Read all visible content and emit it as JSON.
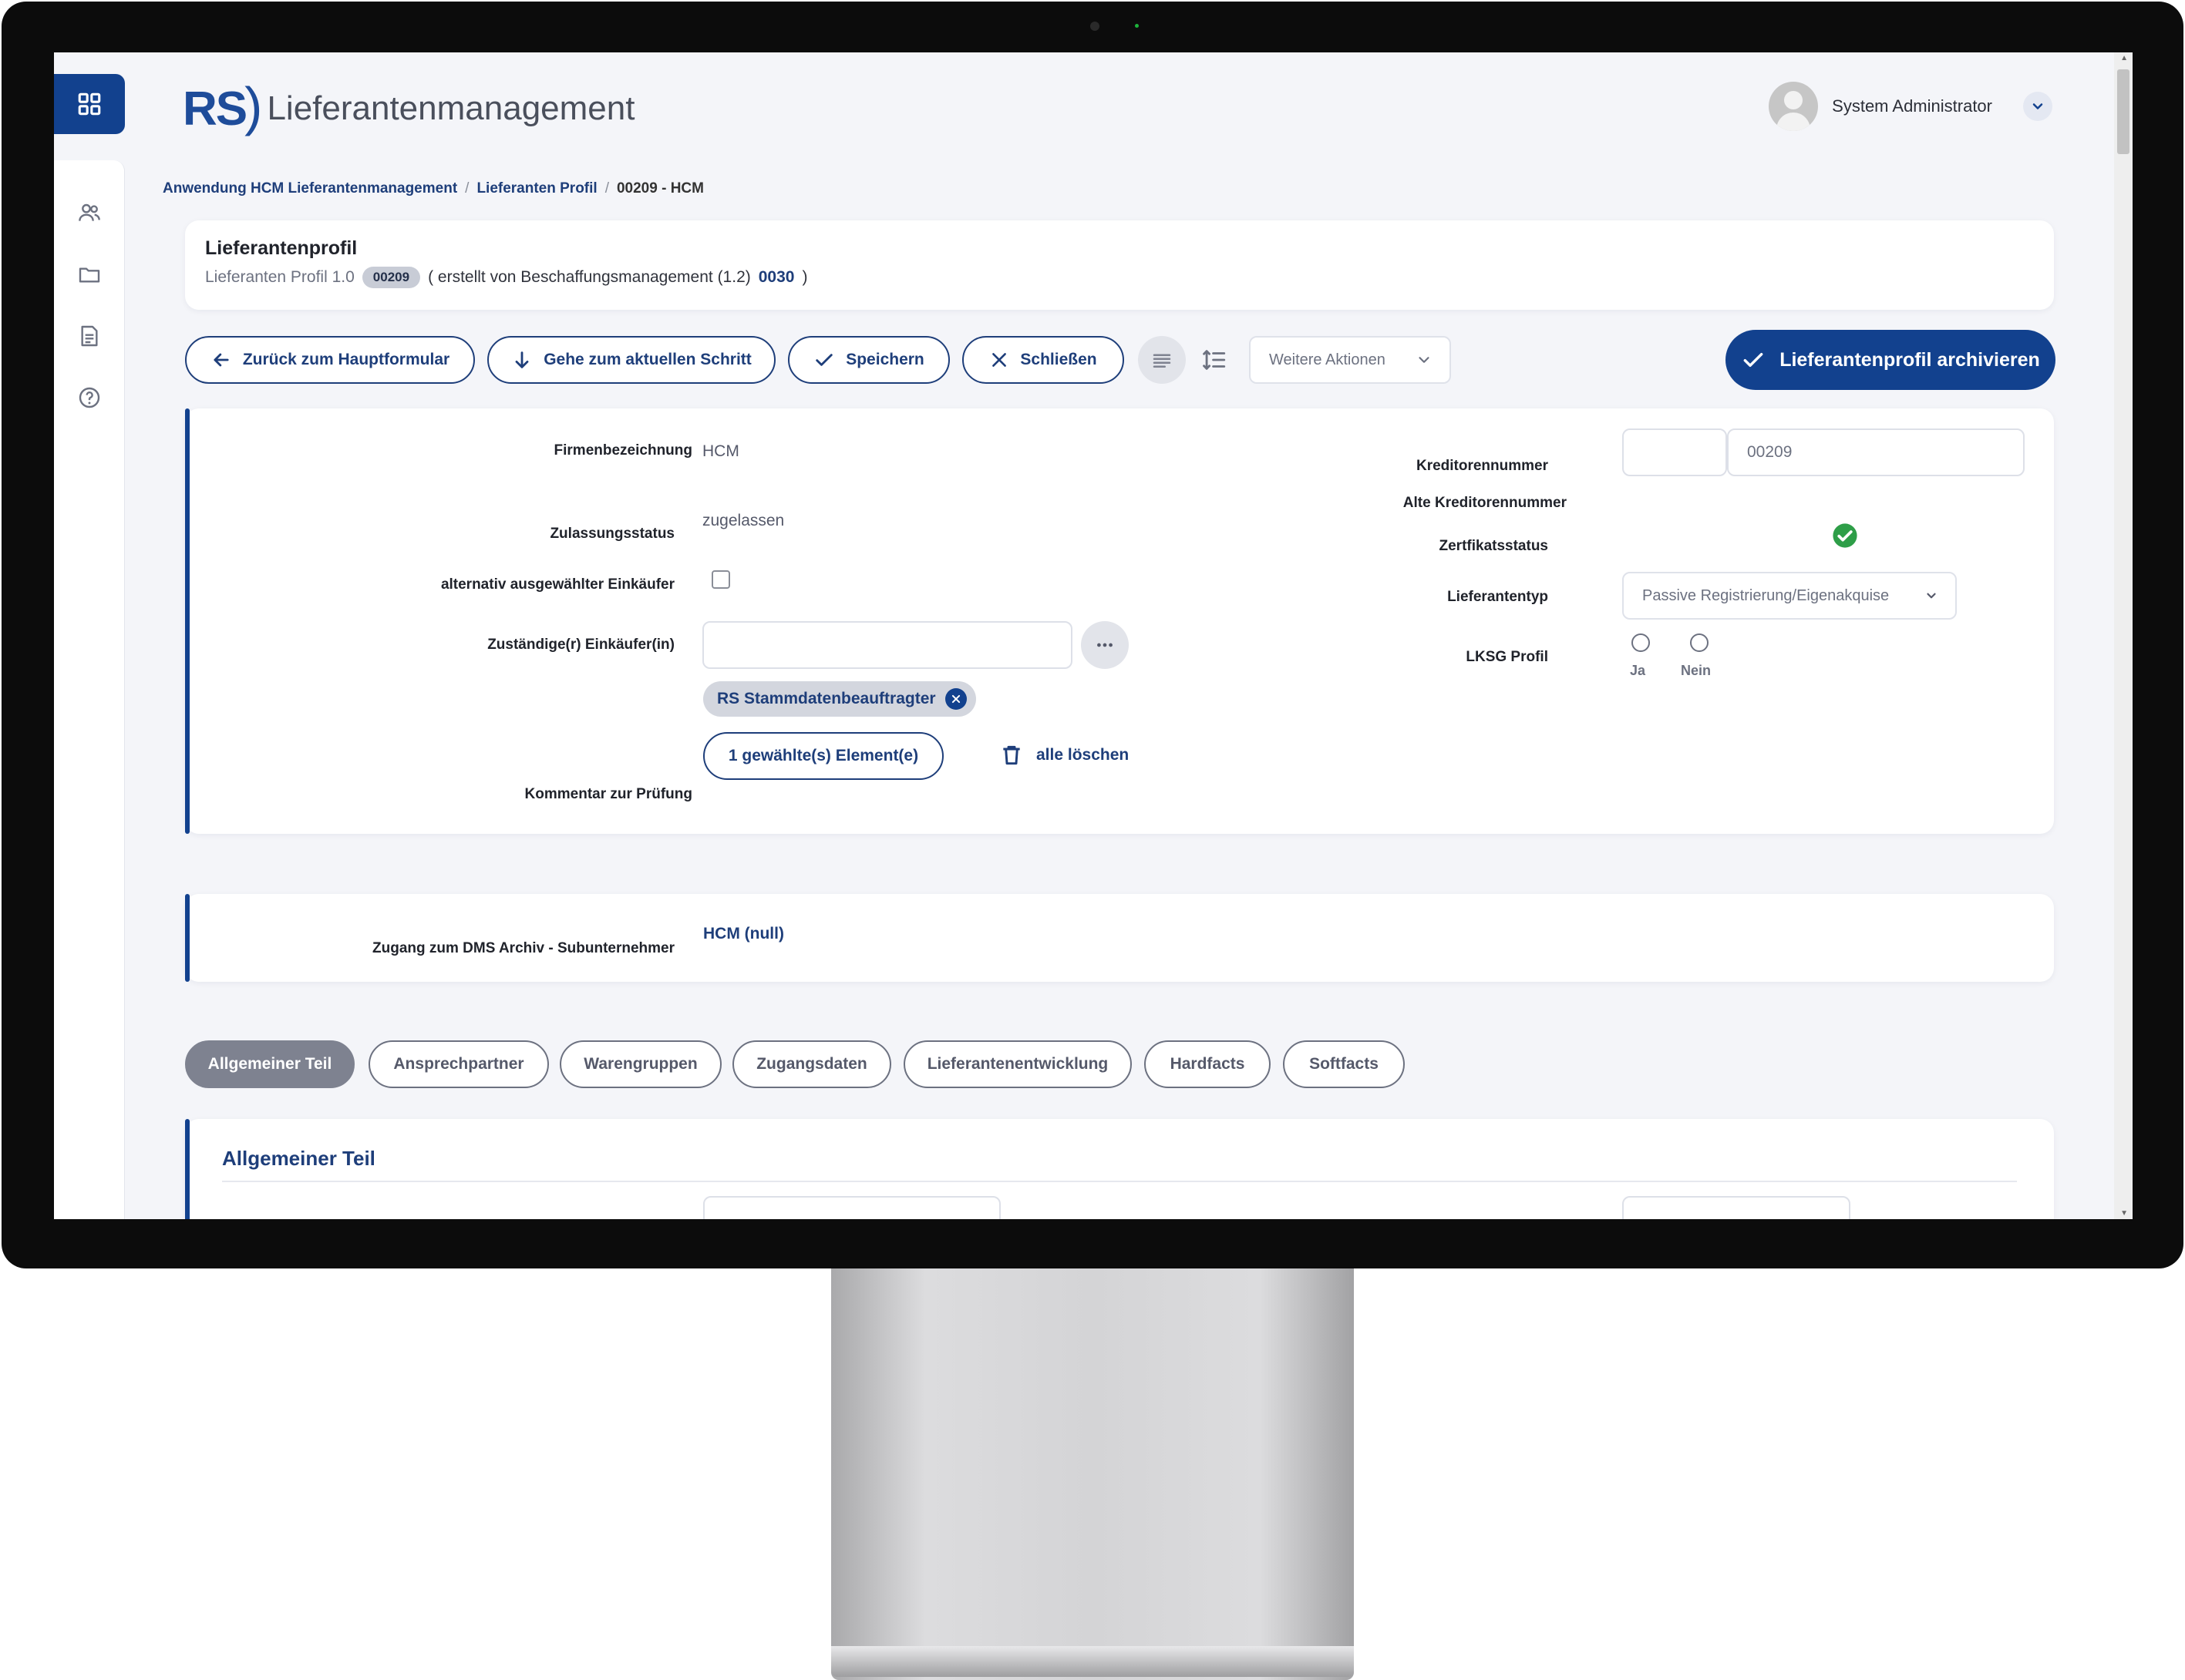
{
  "header": {
    "logo_mark": "RS",
    "app_title": "Lieferantenmanagement",
    "user_name": "System Administrator"
  },
  "breadcrumb": [
    "Anwendung HCM Lieferantenmanagement",
    "Lieferanten Profil",
    "00209 - HCM"
  ],
  "profile": {
    "title": "Lieferantenprofil",
    "version": "Lieferanten Profil 1.0",
    "badge": "00209",
    "created_prefix": "( erstellt von Beschaffungsmanagement (1.2)",
    "created_code": "0030",
    "created_suffix": ")"
  },
  "toolbar": {
    "back": "Zurück zum Hauptformular",
    "goto_step": "Gehe zum aktuellen Schritt",
    "save": "Speichern",
    "close": "Schließen",
    "more_actions": "Weitere Aktionen",
    "archive": "Lieferantenprofil archivieren"
  },
  "form": {
    "firmenbezeichnung_label": "Firmenbezeichnung",
    "firmenbezeichnung_value": "HCM",
    "zulassungsstatus_label": "Zulassungsstatus",
    "zulassungsstatus_value": "zugelassen",
    "alt_einkaeufer_label": "alternativ ausgewählter Einkäufer",
    "einkaeufer_label": "Zuständige(r) Einkäufer(in)",
    "chip": "RS Stammdatenbeauftragter",
    "selected_count": "1 gewählte(s) Element(e)",
    "clear_all": "alle löschen",
    "kommentar_label": "Kommentar zur Prüfung",
    "kreditorennummer_label": "Kreditorennummer",
    "kreditorennummer_value": "00209",
    "alte_kreditorennummer_label": "Alte Kreditorennummer",
    "zertifikatsstatus_label": "Zertfikatsstatus",
    "lieferantentyp_label": "Lieferantentyp",
    "lieferantentyp_value": "Passive Registrierung/Eigenakquise",
    "lksg_label": "LKSG Profil",
    "lksg_yes": "Ja",
    "lksg_no": "Nein"
  },
  "dms": {
    "label": "Zugang zum DMS Archiv - Subunternehmer",
    "value": "HCM (null)"
  },
  "tabs": [
    {
      "label": "Allgemeiner Teil"
    },
    {
      "label": "Ansprechpartner"
    },
    {
      "label": "Warengruppen"
    },
    {
      "label": "Zugangsdaten"
    },
    {
      "label": "Lieferantenentwicklung"
    },
    {
      "label": "Hardfacts"
    },
    {
      "label": "Softfacts"
    }
  ],
  "section": {
    "title": "Allgemeiner Teil"
  },
  "colors": {
    "primary": "#12418e",
    "success": "#2e9e48"
  }
}
